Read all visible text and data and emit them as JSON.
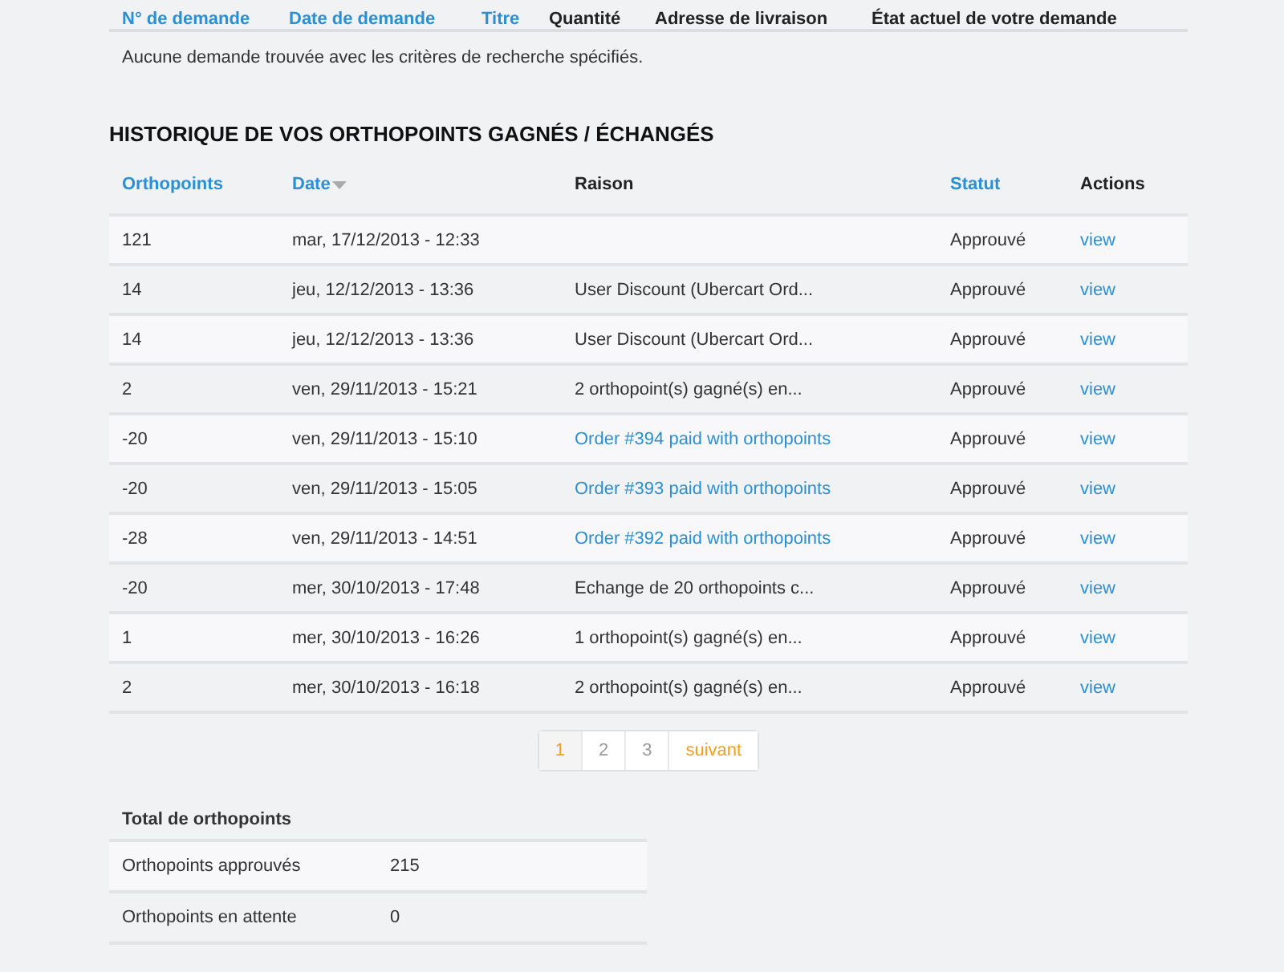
{
  "requests_table": {
    "columns": [
      {
        "label": "N° de demande",
        "sortable": true
      },
      {
        "label": "Date de demande",
        "sortable": true
      },
      {
        "label": "Titre",
        "sortable": true
      },
      {
        "label": "Quantité",
        "sortable": false
      },
      {
        "label": "Adresse de livraison",
        "sortable": false
      },
      {
        "label": "État actuel de votre demande",
        "sortable": false
      }
    ],
    "empty_message": "Aucune demande trouvée avec les critères de recherche spécifiés."
  },
  "history": {
    "title": "HISTORIQUE DE VOS ORTHOPOINTS GAGNÉS / ÉCHANGÉS",
    "columns": [
      {
        "label": "Orthopoints",
        "sortable": true,
        "sorted": false
      },
      {
        "label": "Date",
        "sortable": true,
        "sorted": true
      },
      {
        "label": "Raison",
        "sortable": false,
        "sorted": false
      },
      {
        "label": "Statut",
        "sortable": true,
        "sorted": false
      },
      {
        "label": "Actions",
        "sortable": false,
        "sorted": false
      }
    ],
    "rows": [
      {
        "points": "121",
        "date": "mar, 17/12/2013 - 12:33",
        "reason": "",
        "status": "Approuvé",
        "action": "view"
      },
      {
        "points": "14",
        "date": "jeu, 12/12/2013 - 13:36",
        "reason": "User Discount (Ubercart Ord...",
        "reason_link": false,
        "status": "Approuvé",
        "action": "view"
      },
      {
        "points": "14",
        "date": "jeu, 12/12/2013 - 13:36",
        "reason": "User Discount (Ubercart Ord...",
        "reason_link": false,
        "status": "Approuvé",
        "action": "view"
      },
      {
        "points": "2",
        "date": "ven, 29/11/2013 - 15:21",
        "reason": "2 orthopoint(s) gagné(s) en...",
        "reason_link": false,
        "status": "Approuvé",
        "action": "view"
      },
      {
        "points": "-20",
        "date": "ven, 29/11/2013 - 15:10",
        "reason": "Order #394 paid with orthopoints",
        "reason_link": true,
        "status": "Approuvé",
        "action": "view"
      },
      {
        "points": "-20",
        "date": "ven, 29/11/2013 - 15:05",
        "reason": "Order #393 paid with orthopoints",
        "reason_link": true,
        "status": "Approuvé",
        "action": "view"
      },
      {
        "points": "-28",
        "date": "ven, 29/11/2013 - 14:51",
        "reason": "Order #392 paid with orthopoints",
        "reason_link": true,
        "status": "Approuvé",
        "action": "view"
      },
      {
        "points": "-20",
        "date": "mer, 30/10/2013 - 17:48",
        "reason": "Echange de 20 orthopoints c...",
        "reason_link": false,
        "status": "Approuvé",
        "action": "view"
      },
      {
        "points": "1",
        "date": "mer, 30/10/2013 - 16:26",
        "reason": "1 orthopoint(s) gagné(s) en...",
        "reason_link": false,
        "status": "Approuvé",
        "action": "view"
      },
      {
        "points": "2",
        "date": "mer, 30/10/2013 - 16:18",
        "reason": "2 orthopoint(s) gagné(s) en...",
        "reason_link": false,
        "status": "Approuvé",
        "action": "view"
      }
    ]
  },
  "pagination": {
    "pages": [
      {
        "label": "1",
        "selected": true
      },
      {
        "label": "2",
        "selected": false
      },
      {
        "label": "3",
        "selected": false
      }
    ],
    "next": "suivant"
  },
  "totals": {
    "title": "Total de orthopoints",
    "rows": [
      {
        "label": "Orthopoints approuvés",
        "value": "215"
      },
      {
        "label": "Orthopoints en attente",
        "value": "0"
      }
    ]
  }
}
